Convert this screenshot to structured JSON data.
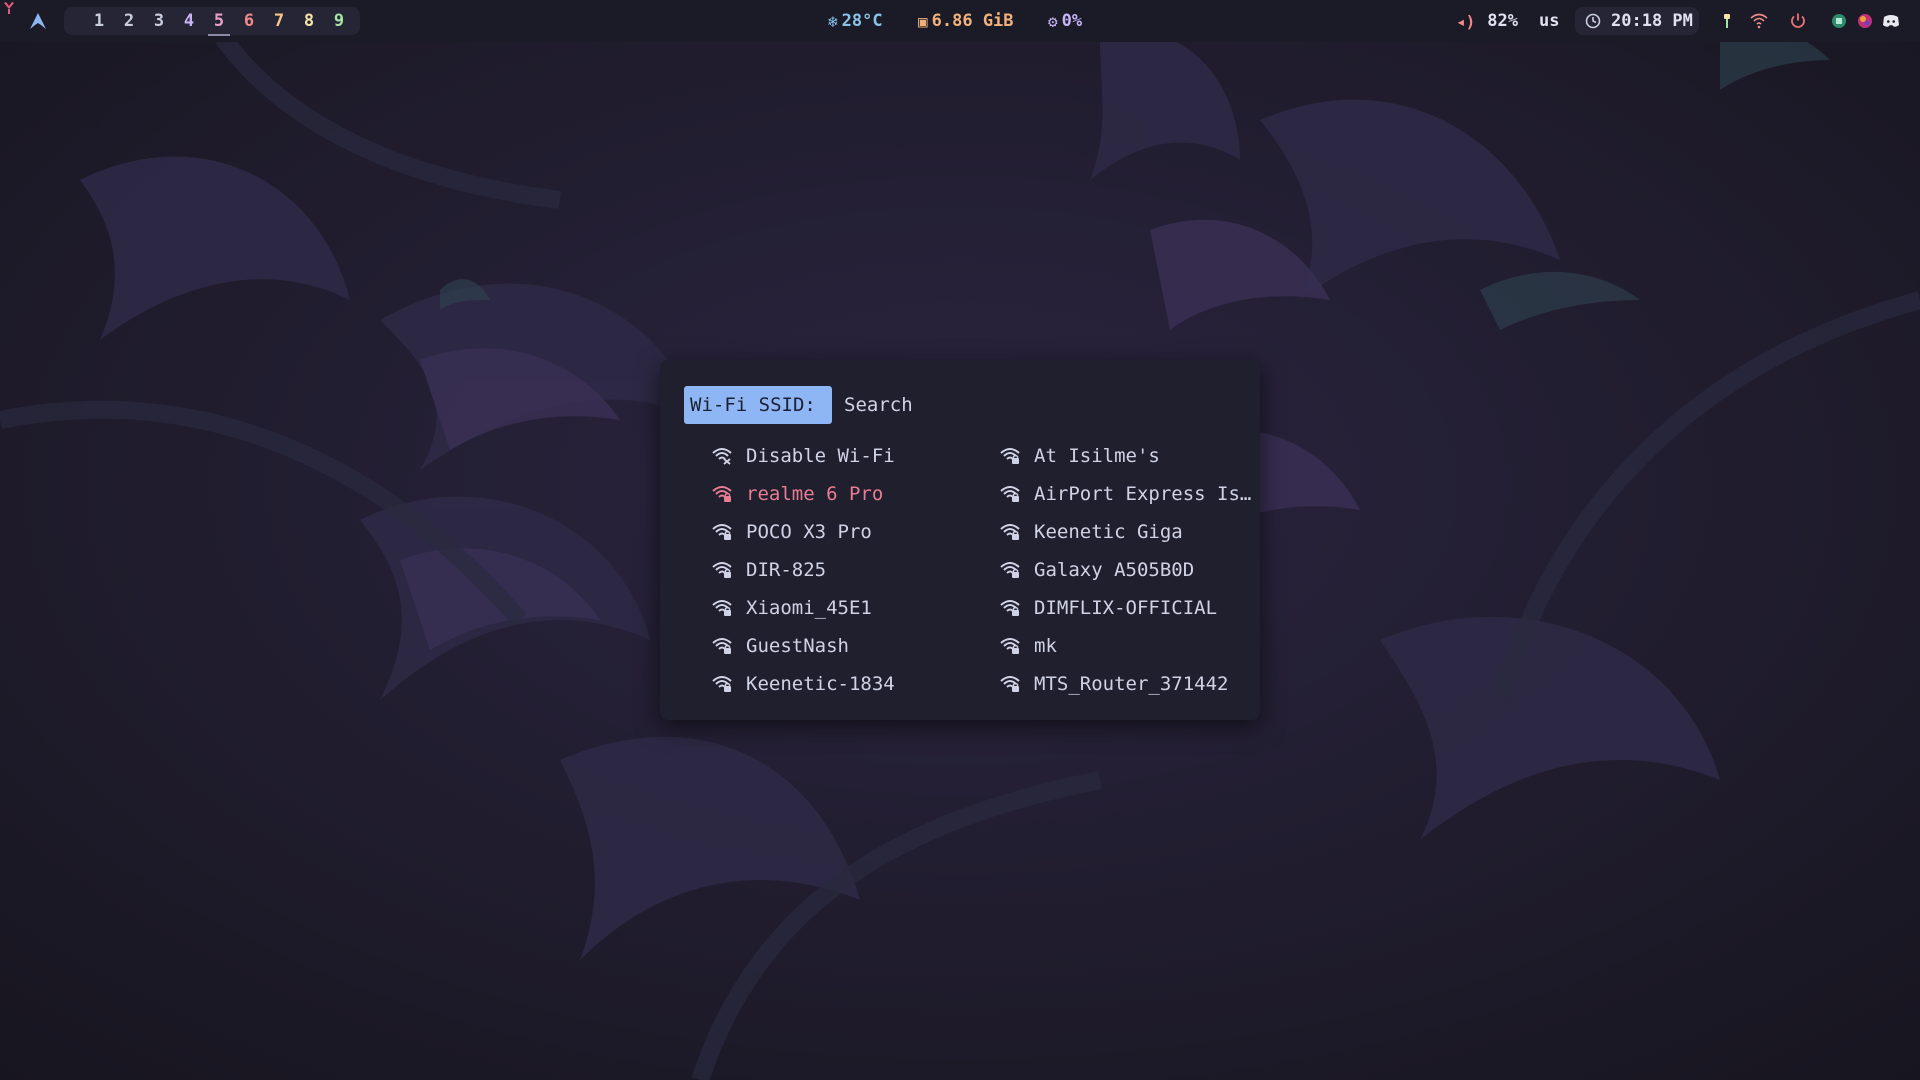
{
  "colors": {
    "bar_bg": "#1b1b27",
    "launcher_bg": "#1f1f2d",
    "prompt_bg": "#8fb6f4",
    "selected_text": "#e87c93",
    "temp": "#89c4e8",
    "ram": "#f0b27a",
    "cpu": "#c8b4f5",
    "volume": "#f08a8a"
  },
  "topbar": {
    "workspaces": [
      {
        "label": "1",
        "color": "#c9cde0"
      },
      {
        "label": "2",
        "color": "#c9cde0"
      },
      {
        "label": "3",
        "color": "#c9cde0"
      },
      {
        "label": "4",
        "color": "#c8b4f5"
      },
      {
        "label": "5",
        "color": "#e8a0c8"
      },
      {
        "label": "6",
        "color": "#f08a8a"
      },
      {
        "label": "7",
        "color": "#f7c48a"
      },
      {
        "label": "8",
        "color": "#f3e1a6"
      },
      {
        "label": "9",
        "color": "#a6e3a1"
      }
    ],
    "active_workspace": "5",
    "temperature": {
      "icon": "snowflake-icon",
      "text": "28°C"
    },
    "memory": {
      "icon": "memory-chip-icon",
      "text": "6.86 GiB"
    },
    "cpu": {
      "icon": "cpu-icon",
      "text": "0%"
    },
    "volume": {
      "icon": "speaker-icon",
      "text": "82%"
    },
    "keyboard_layout": "us",
    "clock": {
      "icon": "clock-icon",
      "text": "20:18 PM"
    },
    "tray": [
      "torch-icon",
      "wifi-icon",
      "power-icon",
      "app-tray-icon",
      "colorful-app-icon",
      "discord-icon"
    ]
  },
  "launcher": {
    "prompt": "Wi-Fi SSID:",
    "search_placeholder": "Search",
    "left_column": [
      {
        "label": "Disable Wi-Fi",
        "icon": "wifi-off-icon"
      },
      {
        "label": "realme 6 Pro",
        "icon": "wifi-lock-icon",
        "selected": true
      },
      {
        "label": "POCO X3 Pro",
        "icon": "wifi-lock-icon"
      },
      {
        "label": "DIR-825",
        "icon": "wifi-lock-icon"
      },
      {
        "label": "Xiaomi_45E1",
        "icon": "wifi-lock-icon"
      },
      {
        "label": "GuestNash",
        "icon": "wifi-lock-icon"
      },
      {
        "label": "Keenetic-1834",
        "icon": "wifi-lock-icon"
      }
    ],
    "right_column": [
      {
        "label": "At Isilme's",
        "icon": "wifi-lock-icon"
      },
      {
        "label": "AirPort Express Is…",
        "icon": "wifi-lock-icon"
      },
      {
        "label": "Keenetic Giga",
        "icon": "wifi-lock-icon"
      },
      {
        "label": "Galaxy A505B0D",
        "icon": "wifi-lock-icon"
      },
      {
        "label": "DIMFLIX-OFFICIAL",
        "icon": "wifi-lock-icon"
      },
      {
        "label": "mk",
        "icon": "wifi-lock-icon"
      },
      {
        "label": "MTS_Router_371442",
        "icon": "wifi-lock-icon"
      }
    ]
  }
}
